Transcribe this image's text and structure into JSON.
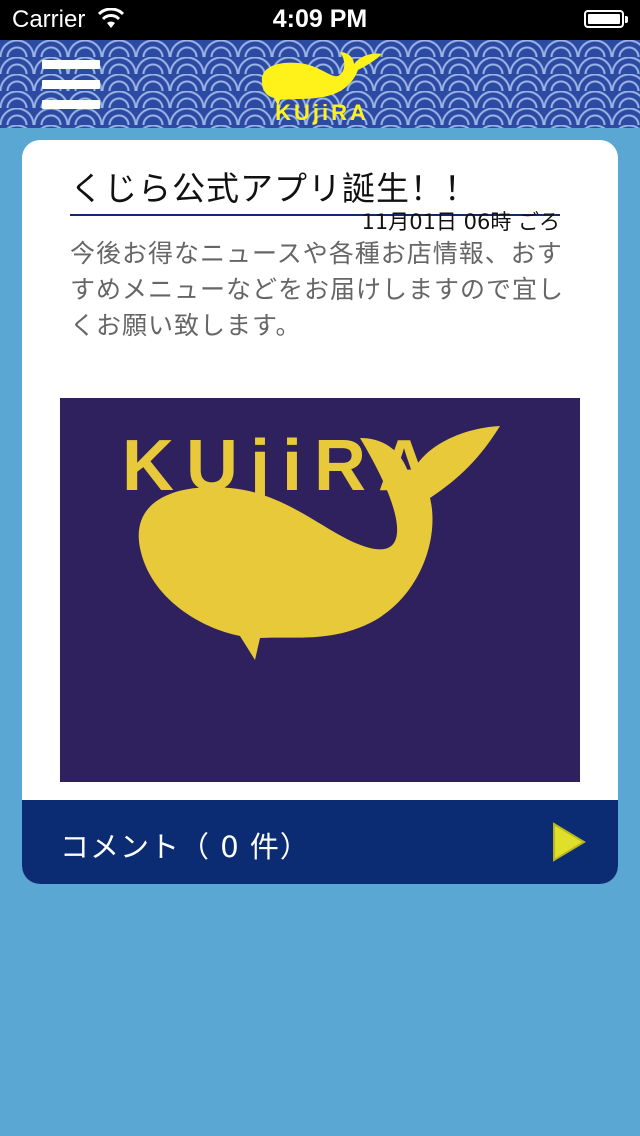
{
  "status_bar": {
    "carrier": "Carrier",
    "time": "4:09 PM"
  },
  "header": {
    "logo_text": "KUjiRA",
    "menu_icon": "hamburger-menu-icon",
    "pattern_color": "#2c4aa2"
  },
  "article": {
    "title": "くじら公式アプリ誕生！！",
    "date": "11月01日 06時 ごろ",
    "body": "今後お得なニュースや各種お店情報、おすすめメニューなどをお届けしますので宜しくお願い致します。",
    "image_text": "KUjiRA"
  },
  "comments": {
    "label": "コメント（ 0 件）",
    "arrow_icon": "play-arrow-icon"
  },
  "colors": {
    "background": "#5aa7d4",
    "navy": "#0b2b73",
    "logo_yellow": "#fff21a",
    "image_yellow": "#e8c93a"
  }
}
